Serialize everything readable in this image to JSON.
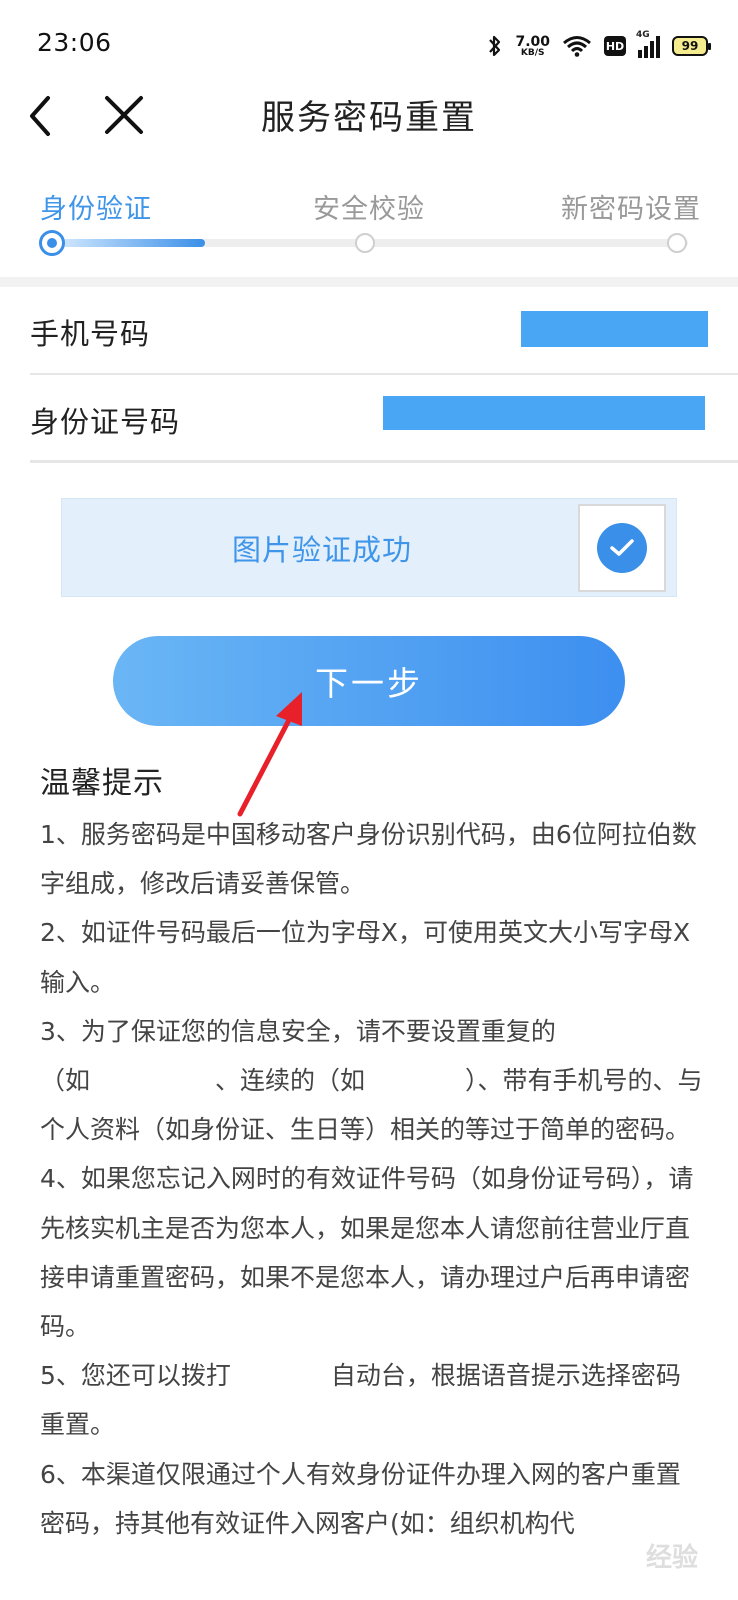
{
  "status_bar": {
    "time": "23:06",
    "net_speed_value": "7.00",
    "net_speed_unit": "KB/S",
    "hd_label": "HD",
    "network_label": "4G",
    "battery": "99",
    "icons": [
      "bluetooth-icon",
      "wifi-icon",
      "hd-icon",
      "signal-icon",
      "battery-icon"
    ]
  },
  "nav": {
    "title": "服务密码重置",
    "back_icon": "chevron-left-icon",
    "close_icon": "close-icon"
  },
  "stepper": {
    "steps": [
      {
        "label": "身份验证",
        "active": true
      },
      {
        "label": "安全校验",
        "active": false
      },
      {
        "label": "新密码设置",
        "active": false
      }
    ],
    "progress": 0.24
  },
  "form": {
    "phone_label": "手机号码",
    "id_label": "身份证号码"
  },
  "captcha": {
    "text": "图片验证成功",
    "checked": true
  },
  "next_button": {
    "label": "下一步"
  },
  "tips": {
    "title": "温馨提示",
    "items": [
      "1、服务密码是中国移动客户身份识别代码，由6位阿拉伯数字组成，修改后请妥善保管。",
      "2、如证件号码最后一位为字母X，可使用英文大小写字母X输入。",
      "3、为了保证您的信息安全，请不要设置重复的（如　　　　　、连续的（如　　　　）、带有手机号的、与个人资料（如身份证、生日等）相关的等过于简单的密码。",
      "4、如果您忘记入网时的有效证件号码（如身份证号码），请先核实机主是否为您本人，如果是您本人请您前往营业厅直接申请重置密码，如果不是您本人，请办理过户后再申请密码。",
      "5、您还可以拨打　　　　自动台，根据语音提示选择密码重置。",
      "6、本渠道仅限通过个人有效身份证件办理入网的客户重置密码，持其他有效证件入网客户(如：组织机构代"
    ]
  },
  "colors": {
    "accent": "#3a8fe8",
    "captcha_bg": "#e3f0fb",
    "redaction": "#49a6f4",
    "annotation_arrow": "#e8202a"
  },
  "watermark": {
    "text": "经验"
  }
}
